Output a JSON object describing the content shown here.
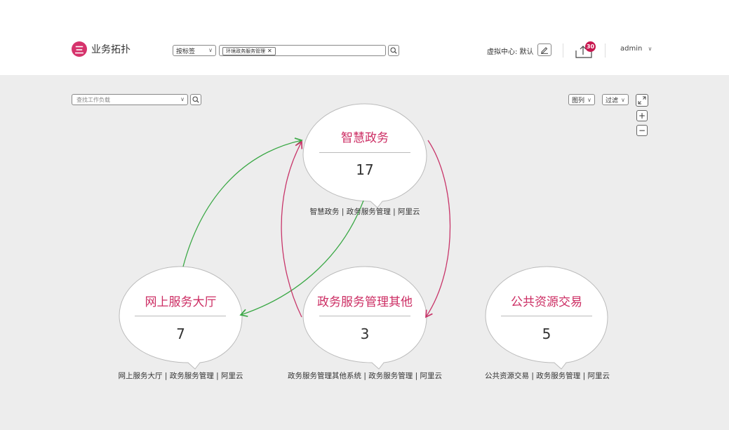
{
  "header": {
    "app_title": "业务拓扑",
    "logo_glyph": "三",
    "filter_mode": "按标签",
    "search_chip": "环境政务服务管理",
    "virtual_center_label": "虚拟中心: 默认",
    "notification_count": "30",
    "user": "admin"
  },
  "toolbar": {
    "workload_placeholder": "查找工作负载",
    "legend_label": "图列",
    "filter_label": "过滤",
    "zoom_in": "+",
    "zoom_out": "−"
  },
  "nodes": [
    {
      "title": "智慧政务",
      "count": "17",
      "caption": "智慧政务 | 政务服务管理 | 阿里云"
    },
    {
      "title": "网上服务大厅",
      "count": "7",
      "caption": "网上服务大厅 | 政务服务管理 | 阿里云"
    },
    {
      "title": "政务服务管理其他",
      "count": "3",
      "caption": "政务服务管理其他系统 | 政务服务管理 | 阿里云"
    },
    {
      "title": "公共资源交易",
      "count": "5",
      "caption": "公共资源交易 | 政务服务管理 | 阿里云"
    }
  ],
  "colors": {
    "accent": "#cc2d63",
    "edge_green": "#3aa845",
    "edge_red": "#c8366a",
    "canvas_bg": "#ededed"
  }
}
